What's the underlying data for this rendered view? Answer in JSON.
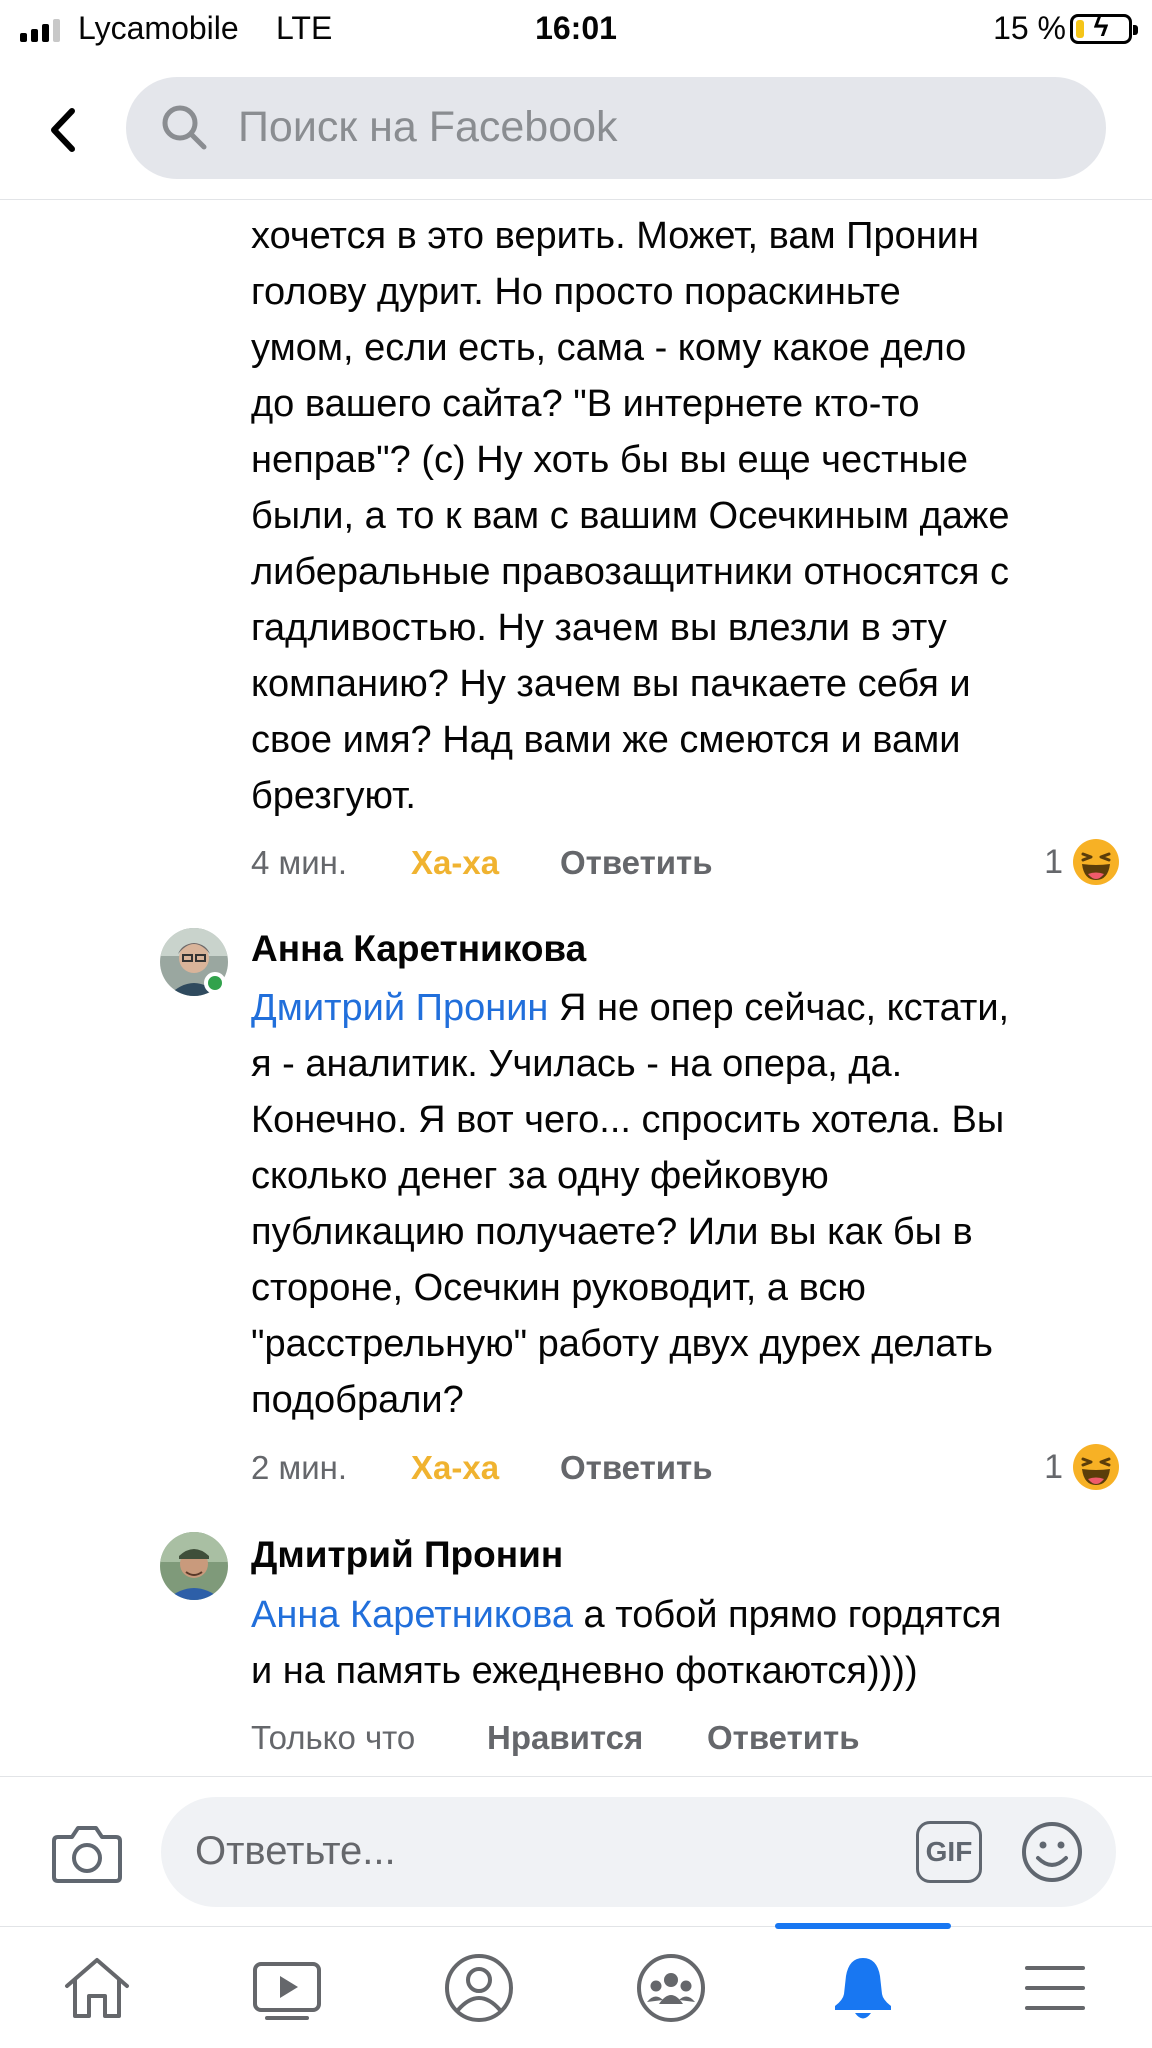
{
  "status_bar": {
    "carrier": "Lycamobile",
    "network": "LTE",
    "time": "16:01",
    "battery_percent": "15 %",
    "battery_level": 0.15
  },
  "header": {
    "search_placeholder": "Поиск на Facebook"
  },
  "comments": [
    {
      "author": "",
      "lines": [
        "хочется в это верить. Может, вам Пронин",
        "голову дурит. Но просто пораскиньте",
        "умом, если есть, сама - кому какое дело",
        "до вашего сайта? \"В интернете кто-то",
        "неправ\"? (с) Ну хоть бы вы еще честные",
        "были, а то к вам с вашим Осечкиным даже",
        "либеральные правозащитники относятся с",
        "гадливостью. Ну зачем вы влезли в эту",
        "компанию? Ну зачем вы пачкаете себя и",
        "свое имя? Над вами же смеются и вами",
        "брезгуют."
      ],
      "time": "4 мин.",
      "reaction_label": "Ха-ха",
      "reply_label": "Ответить",
      "reaction_count": "1",
      "reaction_icon": "haha-emoji-icon"
    },
    {
      "author": "Анна Каретникова",
      "online": true,
      "mention": "Дмитрий Пронин",
      "lines": [
        " Я не опер сейчас, кстати,",
        "я - аналитик. Училась - на опера, да.",
        "Конечно. Я вот чего... спросить хотела. Вы",
        "сколько денег за одну фейковую",
        "публикацию получаете? Или вы как бы в",
        "стороне, Осечкин руководит, а всю",
        "\"расстрельную\" работу двух дурех делать",
        "подобрали?"
      ],
      "time": "2 мин.",
      "reaction_label": "Ха-ха",
      "reply_label": "Ответить",
      "reaction_count": "1",
      "reaction_icon": "haha-emoji-icon"
    },
    {
      "author": "Дмитрий Пронин",
      "online": false,
      "mention": "Анна Каретникова",
      "lines": [
        " а тобой прямо гордятся",
        "и на память ежедневно фоткаются))))"
      ],
      "time": "Только что",
      "like_label": "Нравится",
      "reply_label": "Ответить"
    }
  ],
  "composer": {
    "placeholder": "Ответьте...",
    "gif_label": "GIF",
    "camera_icon": "camera-icon",
    "emoji_icon": "smiley-icon"
  },
  "tab_bar": {
    "tabs": [
      "home-icon",
      "video-icon",
      "profile-icon",
      "groups-icon",
      "notifications-bell-icon",
      "menu-icon"
    ],
    "active_tab": "notifications-bell-icon",
    "accent_color": "#1877f2"
  },
  "colors": {
    "mention": "#216fdb",
    "haha": "#f0b330",
    "muted": "#65676b",
    "online": "#31a24c"
  }
}
